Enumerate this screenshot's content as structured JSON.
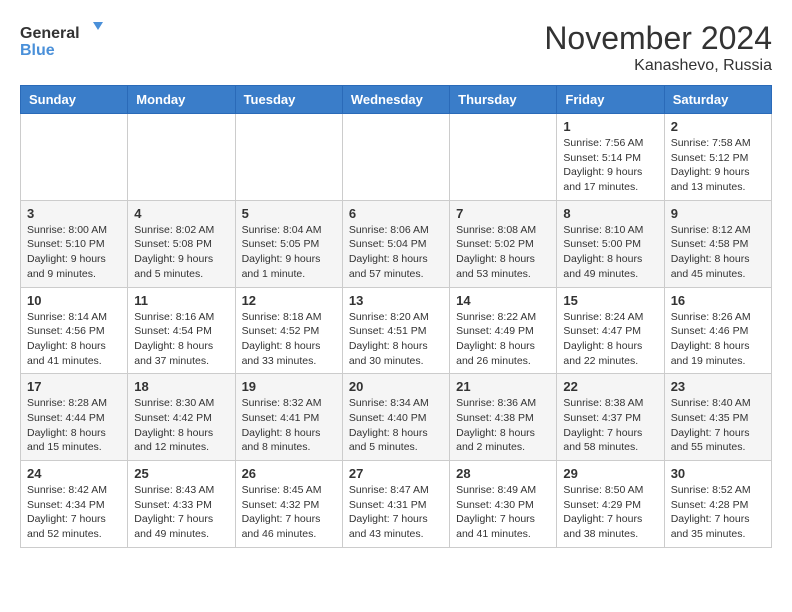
{
  "logo": {
    "general": "General",
    "blue": "Blue"
  },
  "header": {
    "month": "November 2024",
    "location": "Kanashevo, Russia"
  },
  "weekdays": [
    "Sunday",
    "Monday",
    "Tuesday",
    "Wednesday",
    "Thursday",
    "Friday",
    "Saturday"
  ],
  "weeks": [
    [
      {
        "day": "",
        "info": ""
      },
      {
        "day": "",
        "info": ""
      },
      {
        "day": "",
        "info": ""
      },
      {
        "day": "",
        "info": ""
      },
      {
        "day": "",
        "info": ""
      },
      {
        "day": "1",
        "info": "Sunrise: 7:56 AM\nSunset: 5:14 PM\nDaylight: 9 hours and 17 minutes."
      },
      {
        "day": "2",
        "info": "Sunrise: 7:58 AM\nSunset: 5:12 PM\nDaylight: 9 hours and 13 minutes."
      }
    ],
    [
      {
        "day": "3",
        "info": "Sunrise: 8:00 AM\nSunset: 5:10 PM\nDaylight: 9 hours and 9 minutes."
      },
      {
        "day": "4",
        "info": "Sunrise: 8:02 AM\nSunset: 5:08 PM\nDaylight: 9 hours and 5 minutes."
      },
      {
        "day": "5",
        "info": "Sunrise: 8:04 AM\nSunset: 5:05 PM\nDaylight: 9 hours and 1 minute."
      },
      {
        "day": "6",
        "info": "Sunrise: 8:06 AM\nSunset: 5:04 PM\nDaylight: 8 hours and 57 minutes."
      },
      {
        "day": "7",
        "info": "Sunrise: 8:08 AM\nSunset: 5:02 PM\nDaylight: 8 hours and 53 minutes."
      },
      {
        "day": "8",
        "info": "Sunrise: 8:10 AM\nSunset: 5:00 PM\nDaylight: 8 hours and 49 minutes."
      },
      {
        "day": "9",
        "info": "Sunrise: 8:12 AM\nSunset: 4:58 PM\nDaylight: 8 hours and 45 minutes."
      }
    ],
    [
      {
        "day": "10",
        "info": "Sunrise: 8:14 AM\nSunset: 4:56 PM\nDaylight: 8 hours and 41 minutes."
      },
      {
        "day": "11",
        "info": "Sunrise: 8:16 AM\nSunset: 4:54 PM\nDaylight: 8 hours and 37 minutes."
      },
      {
        "day": "12",
        "info": "Sunrise: 8:18 AM\nSunset: 4:52 PM\nDaylight: 8 hours and 33 minutes."
      },
      {
        "day": "13",
        "info": "Sunrise: 8:20 AM\nSunset: 4:51 PM\nDaylight: 8 hours and 30 minutes."
      },
      {
        "day": "14",
        "info": "Sunrise: 8:22 AM\nSunset: 4:49 PM\nDaylight: 8 hours and 26 minutes."
      },
      {
        "day": "15",
        "info": "Sunrise: 8:24 AM\nSunset: 4:47 PM\nDaylight: 8 hours and 22 minutes."
      },
      {
        "day": "16",
        "info": "Sunrise: 8:26 AM\nSunset: 4:46 PM\nDaylight: 8 hours and 19 minutes."
      }
    ],
    [
      {
        "day": "17",
        "info": "Sunrise: 8:28 AM\nSunset: 4:44 PM\nDaylight: 8 hours and 15 minutes."
      },
      {
        "day": "18",
        "info": "Sunrise: 8:30 AM\nSunset: 4:42 PM\nDaylight: 8 hours and 12 minutes."
      },
      {
        "day": "19",
        "info": "Sunrise: 8:32 AM\nSunset: 4:41 PM\nDaylight: 8 hours and 8 minutes."
      },
      {
        "day": "20",
        "info": "Sunrise: 8:34 AM\nSunset: 4:40 PM\nDaylight: 8 hours and 5 minutes."
      },
      {
        "day": "21",
        "info": "Sunrise: 8:36 AM\nSunset: 4:38 PM\nDaylight: 8 hours and 2 minutes."
      },
      {
        "day": "22",
        "info": "Sunrise: 8:38 AM\nSunset: 4:37 PM\nDaylight: 7 hours and 58 minutes."
      },
      {
        "day": "23",
        "info": "Sunrise: 8:40 AM\nSunset: 4:35 PM\nDaylight: 7 hours and 55 minutes."
      }
    ],
    [
      {
        "day": "24",
        "info": "Sunrise: 8:42 AM\nSunset: 4:34 PM\nDaylight: 7 hours and 52 minutes."
      },
      {
        "day": "25",
        "info": "Sunrise: 8:43 AM\nSunset: 4:33 PM\nDaylight: 7 hours and 49 minutes."
      },
      {
        "day": "26",
        "info": "Sunrise: 8:45 AM\nSunset: 4:32 PM\nDaylight: 7 hours and 46 minutes."
      },
      {
        "day": "27",
        "info": "Sunrise: 8:47 AM\nSunset: 4:31 PM\nDaylight: 7 hours and 43 minutes."
      },
      {
        "day": "28",
        "info": "Sunrise: 8:49 AM\nSunset: 4:30 PM\nDaylight: 7 hours and 41 minutes."
      },
      {
        "day": "29",
        "info": "Sunrise: 8:50 AM\nSunset: 4:29 PM\nDaylight: 7 hours and 38 minutes."
      },
      {
        "day": "30",
        "info": "Sunrise: 8:52 AM\nSunset: 4:28 PM\nDaylight: 7 hours and 35 minutes."
      }
    ]
  ]
}
